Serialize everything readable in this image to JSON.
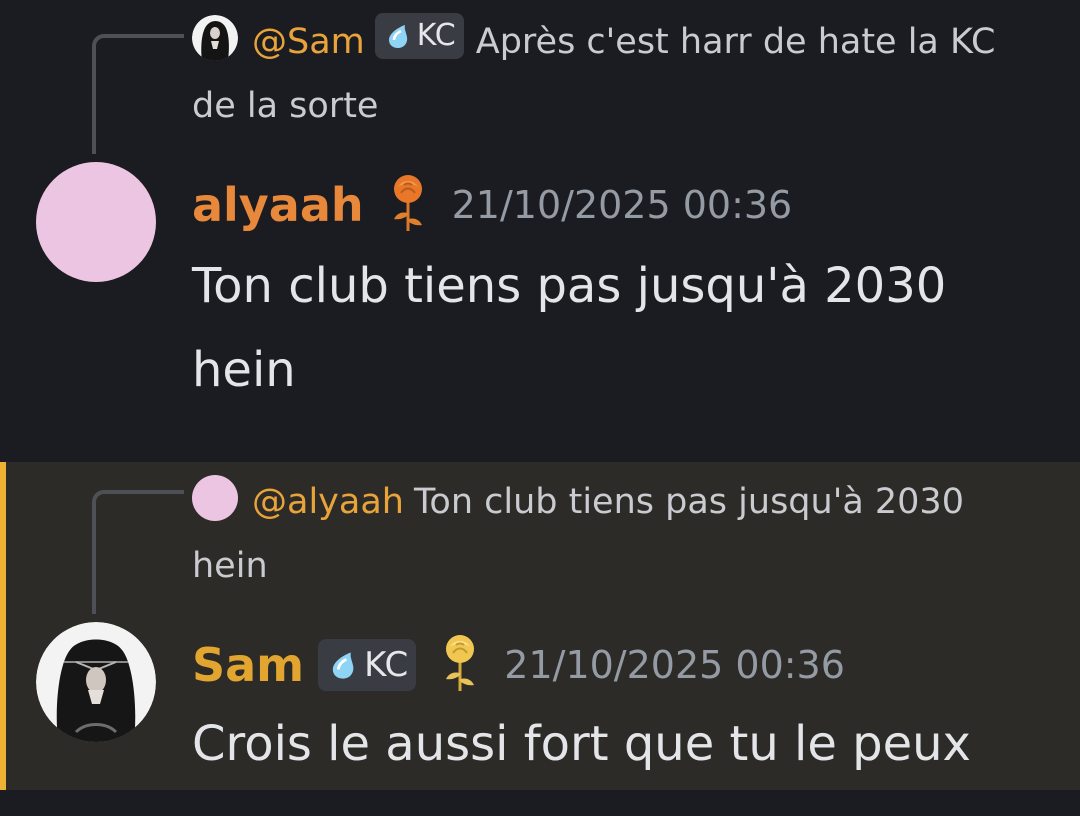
{
  "messages": [
    {
      "reply": {
        "mention": "@Sam",
        "tag": "KC",
        "text": "Après c'est harr de hate la KC de la sorte"
      },
      "author": "alyaah",
      "author_color": "#e8883a",
      "badge_icon": "orange-rose-icon",
      "timestamp": "21/10/2025 00:36",
      "content": "Ton club tiens pas jusqu'à 2030 hein"
    },
    {
      "reply": {
        "mention": "@alyaah",
        "text": "Ton club tiens pas jusqu'à 2030 hein"
      },
      "author": "Sam",
      "author_color": "#e2a52f",
      "tag": "KC",
      "badge_icon": "yellow-rose-icon",
      "timestamp": "21/10/2025 00:36",
      "content": "Crois le aussi fort que tu le peux",
      "highlighted": true
    }
  ],
  "colors": {
    "background": "#1b1c21",
    "highlight_background": "#2d2b28",
    "highlight_bar": "#f0b232",
    "mention": "#e8a33a",
    "timestamp": "#949ba4",
    "text": "#e3e5e8",
    "alyaah_avatar": "#ecc5e2"
  }
}
